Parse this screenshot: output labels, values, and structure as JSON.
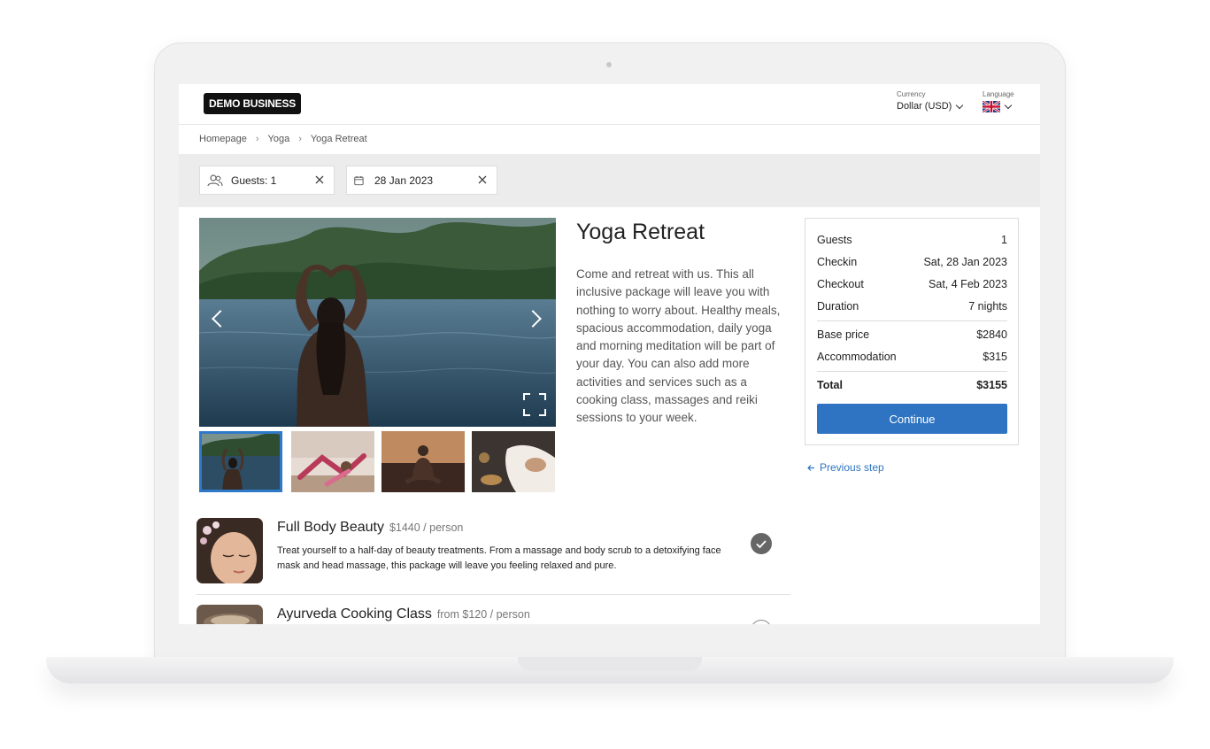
{
  "header": {
    "logo": "DEMO BUSINESS",
    "currency_label": "Currency",
    "currency_value": "Dollar (USD)",
    "language_label": "Language",
    "language_flag_icon": "uk-flag-icon"
  },
  "breadcrumb": [
    "Homepage",
    "Yoga",
    "Yoga Retreat"
  ],
  "filters": {
    "guests": "Guests: 1",
    "date": "28 Jan 2023"
  },
  "product": {
    "title": "Yoga Retreat",
    "description": "Come and retreat with us. This all inclusive package will leave you with nothing to worry about. Healthy meals, spacious accommodation, daily yoga and morning meditation will be part of your day. You can also add more activities and services such as a cooking class, massages and reiki sessions to your week."
  },
  "summary": {
    "rows": [
      {
        "label": "Guests",
        "value": "1"
      },
      {
        "label": "Checkin",
        "value": "Sat, 28 Jan 2023"
      },
      {
        "label": "Checkout",
        "value": "Sat, 4 Feb 2023"
      },
      {
        "label": "Duration",
        "value": "7 nights"
      },
      {
        "label": "Base price",
        "value": "$2840"
      },
      {
        "label": "Accommodation",
        "value": "$315"
      },
      {
        "label": "Total",
        "value": "$3155"
      }
    ],
    "continue_label": "Continue",
    "previous_label": "Previous step"
  },
  "activities": [
    {
      "title": "Full Body Beauty",
      "price": "$1440 / person",
      "description": "Treat yourself to a half-day of beauty treatments. From a massage and body scrub to a detoxifying face mask and head massage, this package will leave you feeling relaxed and pure.",
      "selected": true
    },
    {
      "title": "Ayurveda Cooking Class",
      "price": "from $120 / person",
      "selected": false
    }
  ],
  "colors": {
    "accent": "#2e74c2",
    "filter_bar": "#ececec"
  }
}
